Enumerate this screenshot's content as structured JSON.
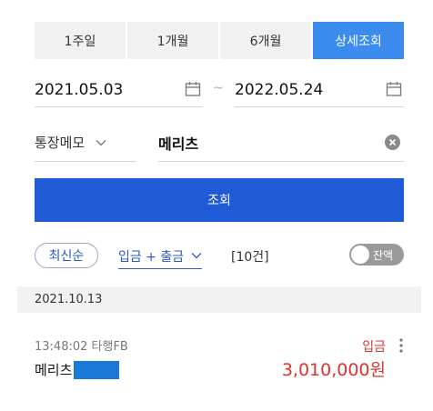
{
  "period_tabs": [
    {
      "label": "1주일",
      "active": false
    },
    {
      "label": "1개월",
      "active": false
    },
    {
      "label": "6개월",
      "active": false
    },
    {
      "label": "상세조회",
      "active": true
    }
  ],
  "date_range": {
    "from": "2021.05.03",
    "separator": "~",
    "to": "2022.05.24",
    "icon": "calendar-icon"
  },
  "memo_filter": {
    "select_label": "통장메모",
    "input_value": "메리츠",
    "clear_icon": "clear-icon"
  },
  "search_button": {
    "label": "조회"
  },
  "filters": {
    "sort": "최신순",
    "type": "입금 + 출금",
    "count": "[10건]",
    "balance_toggle_label": "잔액",
    "balance_toggle_on": false
  },
  "transactions": [
    {
      "date": "2021.10.13",
      "items": [
        {
          "time_bank": "13:48:02 타행FB",
          "memo": "메리츠",
          "type": "입금",
          "amount": "3,010,000원"
        }
      ]
    }
  ],
  "colors": {
    "accent_tab": "#3b8ced",
    "primary_button": "#1f5bd6",
    "link_blue": "#2a59c4",
    "deposit_red": "#e0312f",
    "redaction": "#1a79d8"
  }
}
